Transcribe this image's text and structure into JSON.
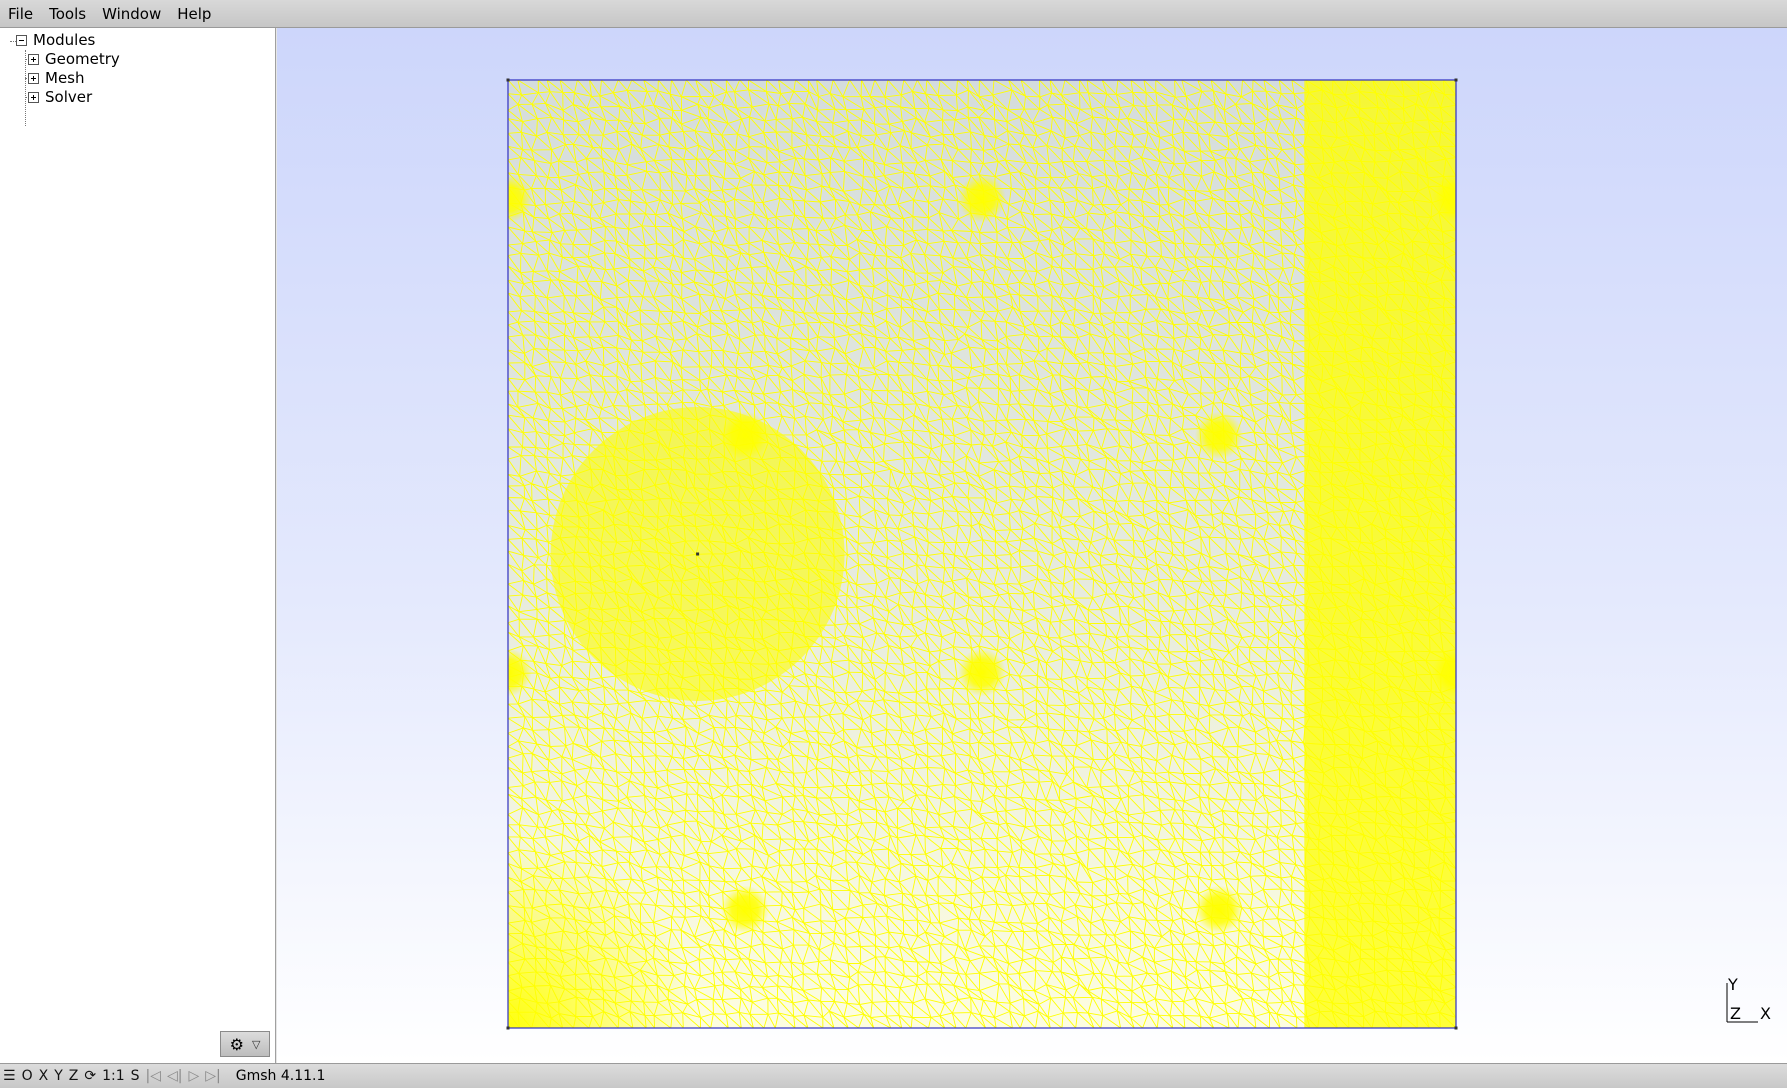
{
  "menu": {
    "file": "File",
    "tools": "Tools",
    "window": "Window",
    "help": "Help"
  },
  "tree": {
    "root": "Modules",
    "children": [
      "Geometry",
      "Mesh",
      "Solver"
    ]
  },
  "statusbar": {
    "menu_icon": "☰",
    "o": "O",
    "x": "X",
    "y": "Y",
    "z": "Z",
    "rotate_icon": "⟳",
    "scale": "1:1",
    "s": "S",
    "first_icon": "|◁",
    "prev_icon": "◁|",
    "play_icon": "▷",
    "last_icon": "▷|",
    "message": "Gmsh 4.11.1"
  },
  "axes": {
    "y": "Y",
    "z": "Z",
    "x": "X"
  },
  "colors": {
    "mesh_line": "#ffff00",
    "boundary": "#3030c0",
    "bg_top": "#cdd6fb",
    "bg_bottom": "#ffffff"
  }
}
